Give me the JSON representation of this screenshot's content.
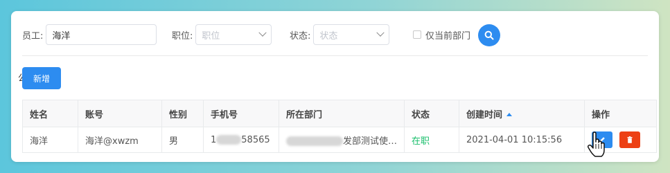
{
  "filters": {
    "employee_label": "员工:",
    "employee_value": "海洋",
    "position_label": "职位:",
    "position_placeholder": "职位",
    "status_label": "状态:",
    "status_placeholder": "状态",
    "current_dept_label": "仅当前部门",
    "current_dept_checked": false
  },
  "toolbar": {
    "add_label": "新增",
    "fragment": "公"
  },
  "table": {
    "headers": [
      "姓名",
      "账号",
      "性别",
      "手机号",
      "所在部门",
      "状态",
      "创建时间",
      "操作"
    ],
    "rows": [
      {
        "name": "海洋",
        "account": "海洋@xwzm",
        "gender": "男",
        "phone_prefix": "1",
        "phone_suffix": "58565",
        "dept_visible": "发部测试使…",
        "status": "在职",
        "created": "2021-04-01 10:15:56"
      }
    ]
  },
  "colors": {
    "primary": "#2d8cf0",
    "danger": "#ed4014",
    "success": "#19be6b"
  }
}
